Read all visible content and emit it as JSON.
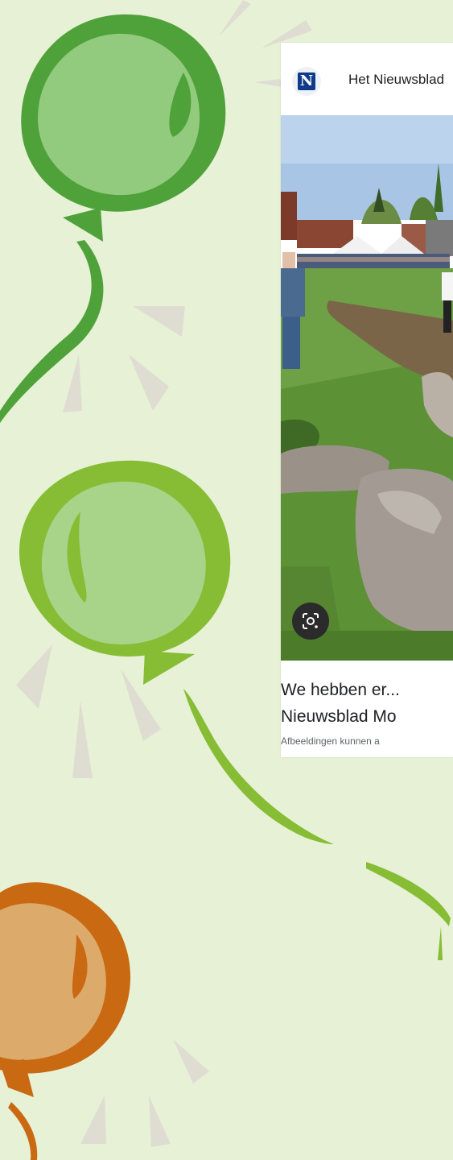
{
  "card": {
    "source_name": "Het Nieuwsblad",
    "logo_letter": "N",
    "caption_line1": "We hebben er...",
    "caption_line2": "Nieuwsblad Mo",
    "disclaimer": "Afbeeldingen kunnen a",
    "lens_icon": "google-lens-icon"
  },
  "colors": {
    "background": "#e7f1d6",
    "balloon_dark_green": "#4fa23a",
    "balloon_light_green": "#93cb7e",
    "balloon_lime": "#86bd35",
    "balloon_orange": "#c96a12",
    "balloon_tan": "#dcaa6b"
  }
}
